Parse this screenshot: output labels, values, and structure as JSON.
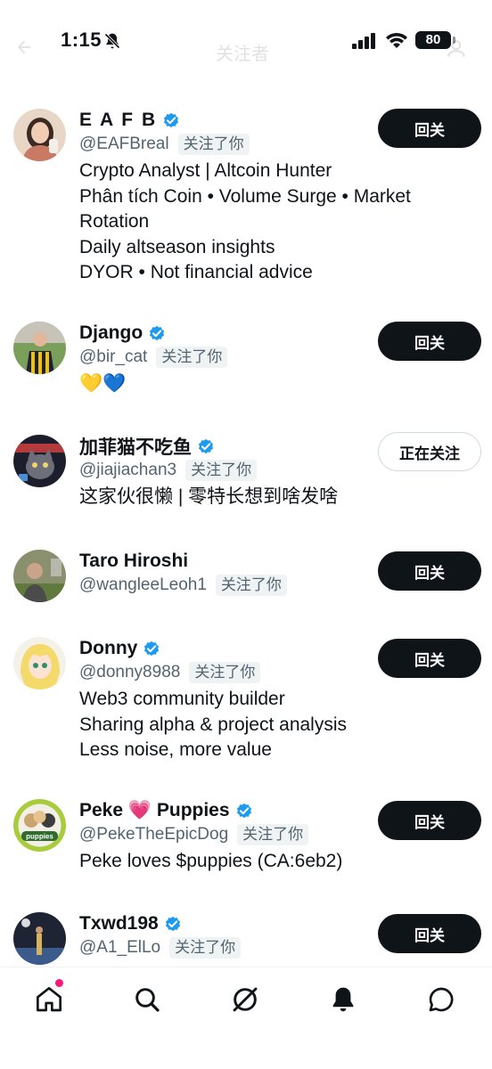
{
  "status": {
    "time": "1:15",
    "battery": "80",
    "icons": [
      "bell-off-icon",
      "signal-icon",
      "wifi-icon",
      "battery-icon"
    ]
  },
  "header": {
    "title": "关注者"
  },
  "users": [
    {
      "name": "E A F B",
      "handle": "@EAFBreal",
      "follows_you": "关注了你",
      "verified": true,
      "bio": [
        "Crypto Analyst | Altcoin Hunter",
        "Phân tích Coin • Volume Surge • Market",
        "Rotation",
        "Daily altseason insights",
        "DYOR • Not financial advice"
      ],
      "button": "回关"
    },
    {
      "name": "Django",
      "handle": "@bir_cat",
      "follows_you": "关注了你",
      "verified": true,
      "bio": [
        "💛💙"
      ],
      "button": "回关"
    },
    {
      "name": "加菲猫不吃鱼",
      "handle": "@jiajiachan3",
      "follows_you": "关注了你",
      "verified": true,
      "bio": [
        "这家伙很懒 | 零特长想到啥发啥"
      ],
      "button": "正在关注"
    },
    {
      "name": "Taro Hiroshi",
      "handle": "@wangleeLeoh1",
      "follows_you": "关注了你",
      "verified": false,
      "bio": [],
      "button": "回关"
    },
    {
      "name": "Donny",
      "handle": "@donny8988",
      "follows_you": "关注了你",
      "verified": true,
      "bio": [
        "Web3 community builder",
        "Sharing alpha & project analysis",
        "Less noise, more value"
      ],
      "button": "回关"
    },
    {
      "name": "Peke 💗 Puppies",
      "handle": "@PekeTheEpicDog",
      "follows_you": "关注了你",
      "verified": true,
      "avatar_text": "puppies",
      "bio": [
        "Peke loves $puppies (CA:6eb2)"
      ],
      "button": "回关"
    },
    {
      "name": "Txwd198",
      "handle": "@A1_ElLo",
      "follows_you": "关注了你",
      "verified": true,
      "bio": [],
      "button": "回关"
    }
  ],
  "bottom_nav": {
    "items": [
      "home-icon",
      "search-icon",
      "grok-icon",
      "notifications-icon",
      "messages-icon"
    ],
    "active": "home-icon"
  },
  "colors": {
    "text": "#0f1419",
    "secondary": "#536471",
    "verified": "#1d9bf0",
    "button": "#0f1419",
    "badge_bg": "#eff3f4",
    "dot": "#f91880"
  }
}
